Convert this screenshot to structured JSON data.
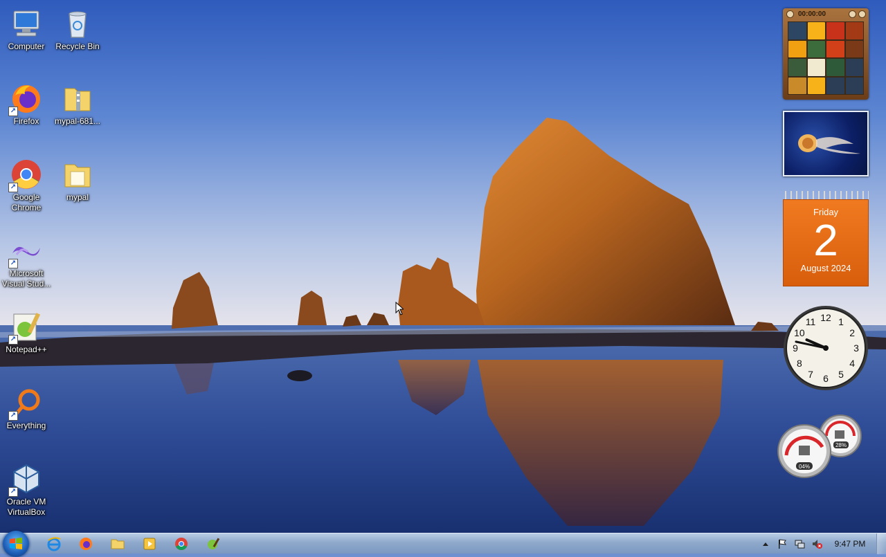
{
  "desktop_icons": [
    {
      "label": "Computer",
      "icon": "computer-icon"
    },
    {
      "label": "Recycle Bin",
      "icon": "recycle-bin-icon"
    },
    {
      "label": "Firefox",
      "icon": "firefox-icon"
    },
    {
      "label": "mypal-681...",
      "icon": "zip-folder-icon"
    },
    {
      "label": "Google Chrome",
      "icon": "chrome-icon"
    },
    {
      "label": "mypal",
      "icon": "folder-icon"
    },
    {
      "label": "Microsoft Visual Stud...",
      "icon": "visual-studio-icon"
    },
    {
      "label": "Notepad++",
      "icon": "notepad-plus-plus-icon"
    },
    {
      "label": "Everything",
      "icon": "everything-search-icon"
    },
    {
      "label": "Oracle VM VirtualBox",
      "icon": "virtualbox-icon"
    }
  ],
  "gadgets": {
    "puzzle": {
      "timer": "00:00:00",
      "tile_colors": [
        "#2c4663",
        "#f7b21a",
        "#c9321a",
        "#a33a16",
        "#f0a010",
        "#3c6b3c",
        "#d2401a",
        "#7a3a18",
        "#3a5c3a",
        "#f2ead0",
        "#2e5a3a",
        "#2b3e55",
        "#c98a2a",
        "#f7b21a",
        "#2b3e55",
        "#2b3e55"
      ]
    },
    "calendar": {
      "weekday": "Friday",
      "day": "2",
      "month_year": "August 2024"
    },
    "clock": {
      "hour": 9,
      "minute": 47
    },
    "cpu_meter": {
      "cpu": "04%",
      "memory": "28%"
    }
  },
  "taskbar": {
    "pinned": [
      "internet-explorer-icon",
      "firefox-icon",
      "file-explorer-icon",
      "media-player-icon",
      "chrome-icon",
      "notepad-plus-plus-icon"
    ],
    "tray": [
      "show-hidden-icons-arrow",
      "action-center-flag-icon",
      "network-icon",
      "volume-muted-icon"
    ],
    "time": "9:47 PM"
  },
  "colors": {
    "calendar_orange": "#e86a14",
    "taskbar": "#8fa9cc",
    "sky_top": "#2f5fc0",
    "sky_bottom": "#dfe6f2"
  }
}
